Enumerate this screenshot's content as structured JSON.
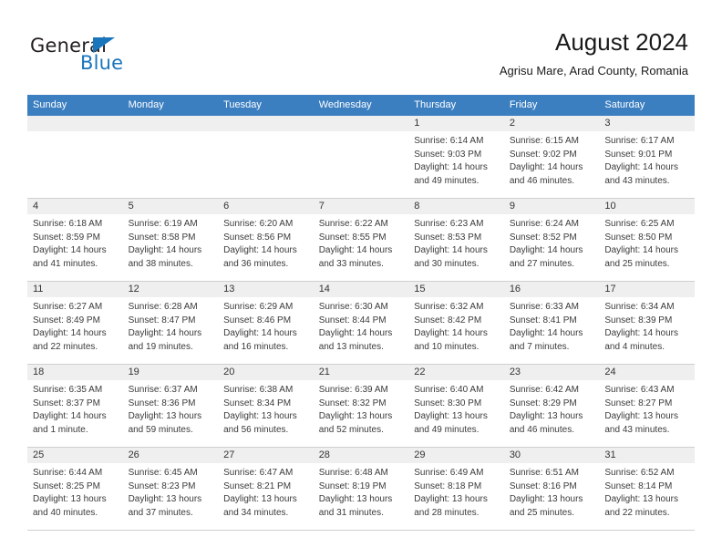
{
  "brand": {
    "name_part1": "General",
    "name_part2": "Blue",
    "logo_icon": "triangle-flag-icon"
  },
  "header": {
    "title": "August 2024",
    "subtitle": "Agrisu Mare, Arad County, Romania"
  },
  "weekday_headers": [
    "Sunday",
    "Monday",
    "Tuesday",
    "Wednesday",
    "Thursday",
    "Friday",
    "Saturday"
  ],
  "colors": {
    "header_blue": "#3c7fc1",
    "brand_blue": "#1a76bc",
    "daynum_bg": "#efefef",
    "grid_line": "#cfcfcf"
  },
  "weeks": [
    [
      {
        "day": "",
        "lines": []
      },
      {
        "day": "",
        "lines": []
      },
      {
        "day": "",
        "lines": []
      },
      {
        "day": "",
        "lines": []
      },
      {
        "day": "1",
        "lines": [
          "Sunrise: 6:14 AM",
          "Sunset: 9:03 PM",
          "Daylight: 14 hours",
          "and 49 minutes."
        ]
      },
      {
        "day": "2",
        "lines": [
          "Sunrise: 6:15 AM",
          "Sunset: 9:02 PM",
          "Daylight: 14 hours",
          "and 46 minutes."
        ]
      },
      {
        "day": "3",
        "lines": [
          "Sunrise: 6:17 AM",
          "Sunset: 9:01 PM",
          "Daylight: 14 hours",
          "and 43 minutes."
        ]
      }
    ],
    [
      {
        "day": "4",
        "lines": [
          "Sunrise: 6:18 AM",
          "Sunset: 8:59 PM",
          "Daylight: 14 hours",
          "and 41 minutes."
        ]
      },
      {
        "day": "5",
        "lines": [
          "Sunrise: 6:19 AM",
          "Sunset: 8:58 PM",
          "Daylight: 14 hours",
          "and 38 minutes."
        ]
      },
      {
        "day": "6",
        "lines": [
          "Sunrise: 6:20 AM",
          "Sunset: 8:56 PM",
          "Daylight: 14 hours",
          "and 36 minutes."
        ]
      },
      {
        "day": "7",
        "lines": [
          "Sunrise: 6:22 AM",
          "Sunset: 8:55 PM",
          "Daylight: 14 hours",
          "and 33 minutes."
        ]
      },
      {
        "day": "8",
        "lines": [
          "Sunrise: 6:23 AM",
          "Sunset: 8:53 PM",
          "Daylight: 14 hours",
          "and 30 minutes."
        ]
      },
      {
        "day": "9",
        "lines": [
          "Sunrise: 6:24 AM",
          "Sunset: 8:52 PM",
          "Daylight: 14 hours",
          "and 27 minutes."
        ]
      },
      {
        "day": "10",
        "lines": [
          "Sunrise: 6:25 AM",
          "Sunset: 8:50 PM",
          "Daylight: 14 hours",
          "and 25 minutes."
        ]
      }
    ],
    [
      {
        "day": "11",
        "lines": [
          "Sunrise: 6:27 AM",
          "Sunset: 8:49 PM",
          "Daylight: 14 hours",
          "and 22 minutes."
        ]
      },
      {
        "day": "12",
        "lines": [
          "Sunrise: 6:28 AM",
          "Sunset: 8:47 PM",
          "Daylight: 14 hours",
          "and 19 minutes."
        ]
      },
      {
        "day": "13",
        "lines": [
          "Sunrise: 6:29 AM",
          "Sunset: 8:46 PM",
          "Daylight: 14 hours",
          "and 16 minutes."
        ]
      },
      {
        "day": "14",
        "lines": [
          "Sunrise: 6:30 AM",
          "Sunset: 8:44 PM",
          "Daylight: 14 hours",
          "and 13 minutes."
        ]
      },
      {
        "day": "15",
        "lines": [
          "Sunrise: 6:32 AM",
          "Sunset: 8:42 PM",
          "Daylight: 14 hours",
          "and 10 minutes."
        ]
      },
      {
        "day": "16",
        "lines": [
          "Sunrise: 6:33 AM",
          "Sunset: 8:41 PM",
          "Daylight: 14 hours",
          "and 7 minutes."
        ]
      },
      {
        "day": "17",
        "lines": [
          "Sunrise: 6:34 AM",
          "Sunset: 8:39 PM",
          "Daylight: 14 hours",
          "and 4 minutes."
        ]
      }
    ],
    [
      {
        "day": "18",
        "lines": [
          "Sunrise: 6:35 AM",
          "Sunset: 8:37 PM",
          "Daylight: 14 hours",
          "and 1 minute."
        ]
      },
      {
        "day": "19",
        "lines": [
          "Sunrise: 6:37 AM",
          "Sunset: 8:36 PM",
          "Daylight: 13 hours",
          "and 59 minutes."
        ]
      },
      {
        "day": "20",
        "lines": [
          "Sunrise: 6:38 AM",
          "Sunset: 8:34 PM",
          "Daylight: 13 hours",
          "and 56 minutes."
        ]
      },
      {
        "day": "21",
        "lines": [
          "Sunrise: 6:39 AM",
          "Sunset: 8:32 PM",
          "Daylight: 13 hours",
          "and 52 minutes."
        ]
      },
      {
        "day": "22",
        "lines": [
          "Sunrise: 6:40 AM",
          "Sunset: 8:30 PM",
          "Daylight: 13 hours",
          "and 49 minutes."
        ]
      },
      {
        "day": "23",
        "lines": [
          "Sunrise: 6:42 AM",
          "Sunset: 8:29 PM",
          "Daylight: 13 hours",
          "and 46 minutes."
        ]
      },
      {
        "day": "24",
        "lines": [
          "Sunrise: 6:43 AM",
          "Sunset: 8:27 PM",
          "Daylight: 13 hours",
          "and 43 minutes."
        ]
      }
    ],
    [
      {
        "day": "25",
        "lines": [
          "Sunrise: 6:44 AM",
          "Sunset: 8:25 PM",
          "Daylight: 13 hours",
          "and 40 minutes."
        ]
      },
      {
        "day": "26",
        "lines": [
          "Sunrise: 6:45 AM",
          "Sunset: 8:23 PM",
          "Daylight: 13 hours",
          "and 37 minutes."
        ]
      },
      {
        "day": "27",
        "lines": [
          "Sunrise: 6:47 AM",
          "Sunset: 8:21 PM",
          "Daylight: 13 hours",
          "and 34 minutes."
        ]
      },
      {
        "day": "28",
        "lines": [
          "Sunrise: 6:48 AM",
          "Sunset: 8:19 PM",
          "Daylight: 13 hours",
          "and 31 minutes."
        ]
      },
      {
        "day": "29",
        "lines": [
          "Sunrise: 6:49 AM",
          "Sunset: 8:18 PM",
          "Daylight: 13 hours",
          "and 28 minutes."
        ]
      },
      {
        "day": "30",
        "lines": [
          "Sunrise: 6:51 AM",
          "Sunset: 8:16 PM",
          "Daylight: 13 hours",
          "and 25 minutes."
        ]
      },
      {
        "day": "31",
        "lines": [
          "Sunrise: 6:52 AM",
          "Sunset: 8:14 PM",
          "Daylight: 13 hours",
          "and 22 minutes."
        ]
      }
    ]
  ]
}
